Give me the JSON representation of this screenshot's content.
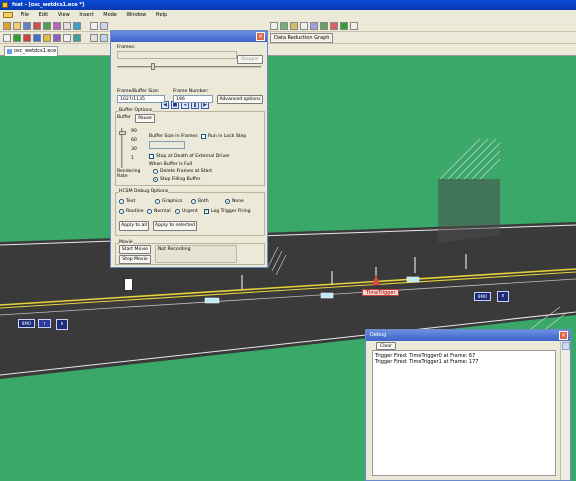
{
  "app": {
    "title": "fsat - [osc_wetdcs1.ece *]"
  },
  "menu": [
    "File",
    "Edit",
    "View",
    "Insert",
    "Mode",
    "Window",
    "Help"
  ],
  "toolbar": {
    "data_reduction_label": "Data Reduction Graph"
  },
  "tab": {
    "label": "osc_wetdcs1.ece"
  },
  "scene": {
    "trigger_label": "TimeTrigger",
    "sign_a": "8MO",
    "sign_b": "8MO",
    "sign_c": "1F"
  },
  "dialog": {
    "frames_label": "Frames:",
    "stop_btn": "Stopper",
    "frame_buffer_size_label": "Frame/Buffer Size:",
    "frame_number_label": "Frame Number:",
    "frame_buffer_size_value": "1027/1135",
    "frame_number_value": "196",
    "advanced_btn": "Advanced options",
    "buffer_options_label": "Buffer Options",
    "buffer_label": "Buffer",
    "pause_btn": "Pause",
    "buffer_size_label": "Buffer Size in Frames",
    "lock_step_label": "Run in Lock Step",
    "rate_values": [
      "90",
      "60",
      "30",
      "1"
    ],
    "rendering_rate_label": "Rendering Rate",
    "stop_death_label": "Stop at Death of External Driver",
    "when_full_label": "When Buffer is Full",
    "delete_frames_label": "Delete Frames at Start",
    "stop_filling_label": "Stop Filling Buffer",
    "debug_options_label": "HCSM Debug Options",
    "opt_text": "Text",
    "opt_graphics": "Graphics",
    "opt_both": "Both",
    "opt_none": "None",
    "opt_routine": "Routine",
    "opt_normal": "Normal",
    "opt_urgent": "Urgent",
    "opt_log": "Log Trigger Firing",
    "apply_all_btn": "Apply to all",
    "apply_selected_btn": "Apply to selected",
    "movie_label": "Movie",
    "start_movie_btn": "Start Movie",
    "stop_movie_btn": "Stop Movie",
    "recording_status": "Not Recording"
  },
  "debug": {
    "title": "Debug",
    "clear_btn": "Clear",
    "lines": [
      "Trigger Fired: TimeTrigger0 at Frame: 67",
      "Trigger Fired: TimeTrigger1 at Frame: 177"
    ]
  },
  "colors": {
    "grass": "#3aa869",
    "road": "#3c3c3c",
    "lane": "#e8d23a",
    "title": "#0a4bd8"
  }
}
